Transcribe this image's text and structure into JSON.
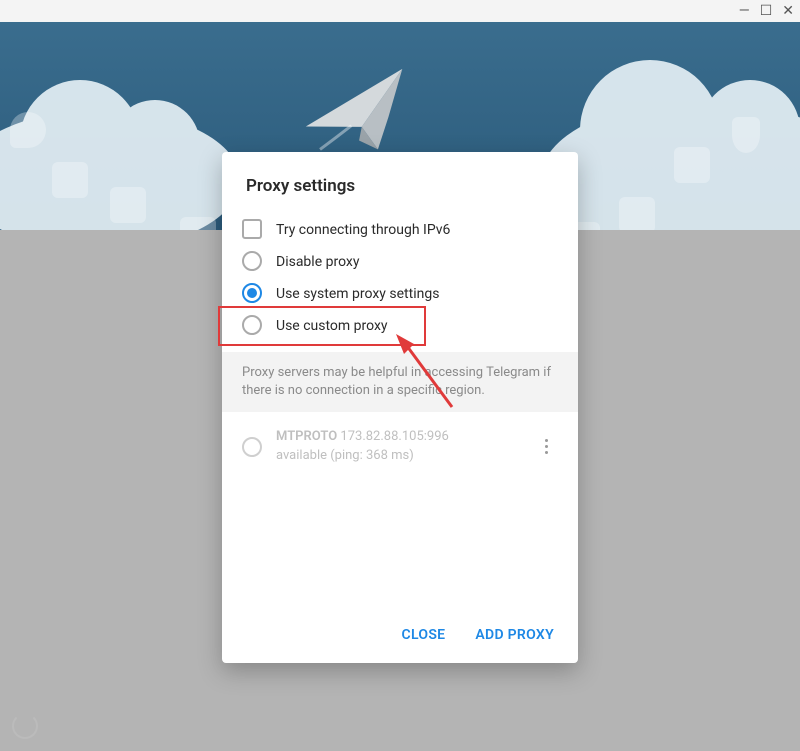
{
  "window": {
    "minimize": "—",
    "maximize": "☐",
    "close": "✕"
  },
  "dialog": {
    "title": "Proxy settings",
    "options": {
      "ipv6": "Try connecting through IPv6",
      "disable": "Disable proxy",
      "system": "Use system proxy settings",
      "custom": "Use custom proxy"
    },
    "info": "Proxy servers may be helpful in accessing Telegram if there is no connection in a specific region.",
    "proxies": [
      {
        "protocol": "MTPROTO",
        "address": "173.82.88.105:996",
        "status": "available (ping: 368 ms)"
      }
    ],
    "buttons": {
      "close": "CLOSE",
      "add": "ADD PROXY"
    }
  }
}
